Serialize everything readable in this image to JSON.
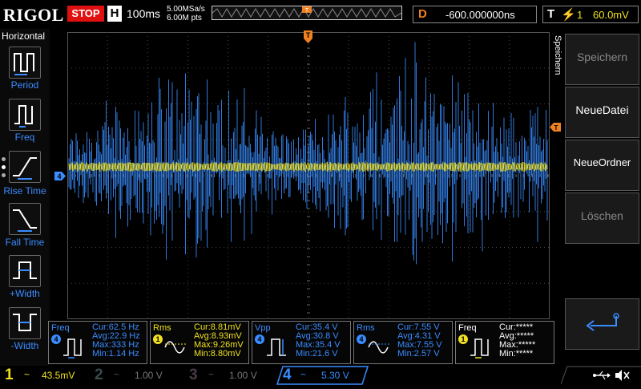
{
  "header": {
    "logo": "RIGOL",
    "run_state": "STOP",
    "horizontal_label": "H",
    "timebase": "100ms",
    "sample_rate": "5.00MSa/s",
    "memory_depth": "6.00M pts",
    "delay_label": "D",
    "delay_value": "-600.000000ns",
    "trigger_label": "T",
    "trigger_source": "1",
    "trigger_level": "60.0mV"
  },
  "left_panel": {
    "title": "Horizontal",
    "items": [
      {
        "label": "Period",
        "icon": "period-icon"
      },
      {
        "label": "Freq",
        "icon": "freq-icon"
      },
      {
        "label": "Rise Time",
        "icon": "rise-time-icon"
      },
      {
        "label": "Fall Time",
        "icon": "fall-time-icon"
      },
      {
        "label": "+Width",
        "icon": "positive-width-icon"
      },
      {
        "label": "-Width",
        "icon": "negative-width-icon"
      }
    ]
  },
  "right_menu": {
    "title": "Speichern",
    "items": [
      {
        "label": "Speichern",
        "enabled": false
      },
      {
        "label": "NeueDatei",
        "enabled": true
      },
      {
        "label": "NeueOrdner",
        "enabled": true
      },
      {
        "label": "Löschen",
        "enabled": false
      }
    ],
    "back_icon": "return-arrow-icon"
  },
  "markers": {
    "trigger_position": "T",
    "channel4_marker": "4"
  },
  "measurements": [
    {
      "name": "Freq",
      "channel": "4",
      "color": "#3a8cff",
      "cur": "Cur:62.5 Hz",
      "avg": "Avg:22.9 Hz",
      "max": "Max:333 Hz",
      "min": "Min:1.14 Hz"
    },
    {
      "name": "Rms",
      "channel": "1",
      "color": "#f0e020",
      "cur": "Cur:8.81mV",
      "avg": "Avg:8.93mV",
      "max": "Max:9.26mV",
      "min": "Min:8.80mV"
    },
    {
      "name": "Vpp",
      "channel": "4",
      "color": "#3a8cff",
      "cur": "Cur:35.4 V",
      "avg": "Avg:30.8 V",
      "max": "Max:35.4 V",
      "min": "Min:21.6 V"
    },
    {
      "name": "Rms",
      "channel": "4",
      "color": "#3a8cff",
      "cur": "Cur:7.55 V",
      "avg": "Avg:4.31 V",
      "max": "Max:7.55 V",
      "min": "Min:2.57 V"
    },
    {
      "name": "Freq",
      "channel": "1",
      "color": "#f0e020",
      "cur": "Cur:*****",
      "avg": "Avg:*****",
      "max": "Max:*****",
      "min": "Min:*****"
    }
  ],
  "channels": [
    {
      "num": "1",
      "coupling": "~",
      "scale": "43.5mV",
      "color": "#f0e020",
      "active": true
    },
    {
      "num": "2",
      "coupling": "~",
      "scale": "1.00 V",
      "color": "#30c0c0",
      "active": false
    },
    {
      "num": "3",
      "coupling": "~",
      "scale": "1.00 V",
      "color": "#d040d0",
      "active": false
    },
    {
      "num": "4",
      "coupling": "~",
      "scale": "5.30 V",
      "color": "#3a8cff",
      "active": true
    }
  ],
  "status_icons": [
    "usb-icon",
    "sound-muted-icon"
  ],
  "colors": {
    "ch1": "#f0e020",
    "ch4": "#3a8cff",
    "accent": "#f08020",
    "stop": "#e01010"
  }
}
